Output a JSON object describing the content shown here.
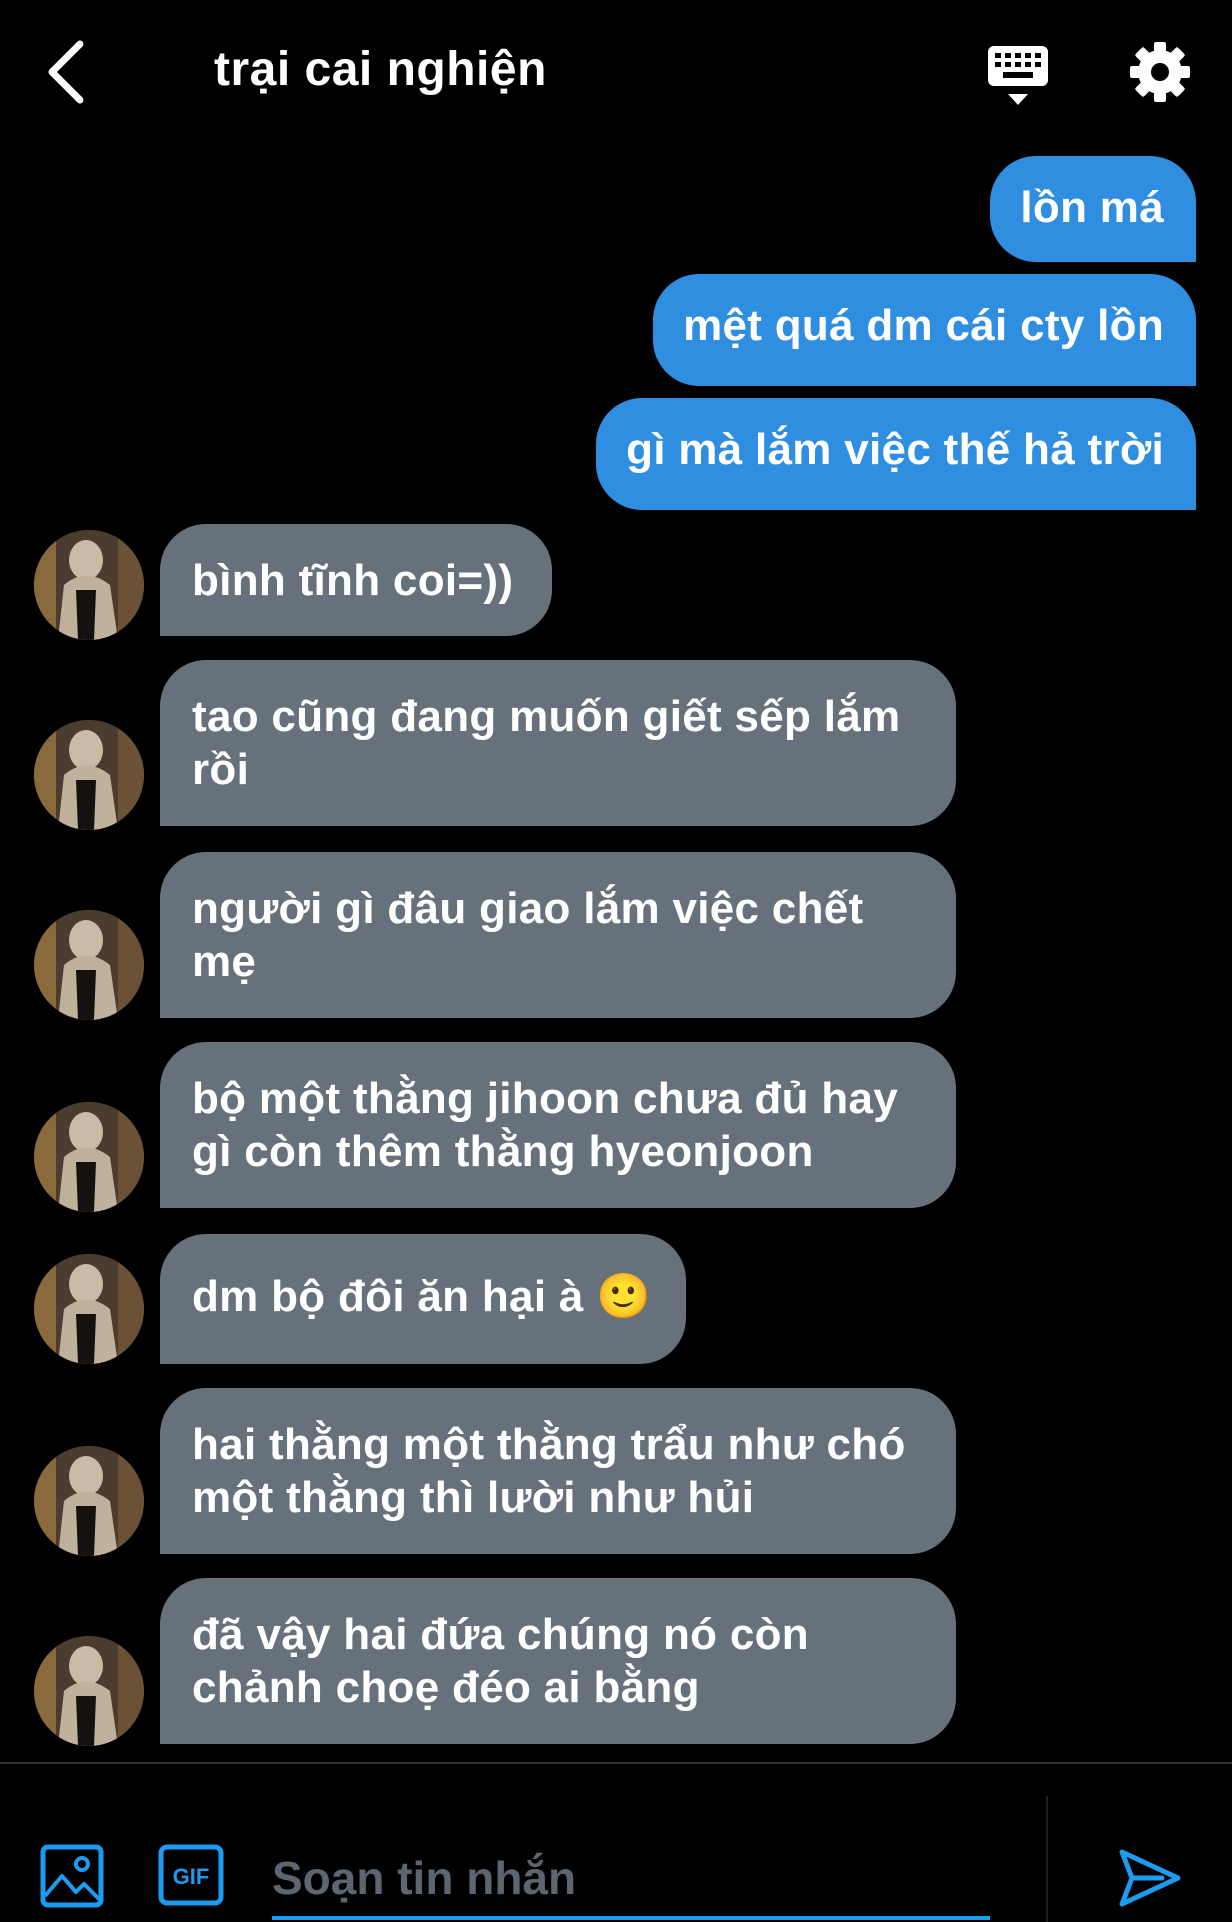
{
  "header": {
    "title": "trại cai nghiện",
    "back_icon": "chevron-left-icon",
    "keyboard_icon": "keyboard-icon",
    "settings_icon": "gear-icon"
  },
  "messages": [
    {
      "direction": "out",
      "text": "lồn má"
    },
    {
      "direction": "out",
      "text": "mệt quá dm cái cty lồn"
    },
    {
      "direction": "out",
      "text": "gì mà lắm việc thế hả trời"
    },
    {
      "direction": "in",
      "text": "bình tĩnh coi=))"
    },
    {
      "direction": "in",
      "text": "tao cũng đang muốn giết sếp lắm rồi"
    },
    {
      "direction": "in",
      "text": "người gì đâu giao lắm việc chết mẹ"
    },
    {
      "direction": "in",
      "text": "bộ một thằng jihoon chưa đủ hay gì còn thêm thằng hyeonjoon"
    },
    {
      "direction": "in",
      "text": "dm bộ đôi ăn hại à 🙂"
    },
    {
      "direction": "in",
      "text": "hai thằng một thằng trẩu như chó một thằng thì lười như hủi"
    },
    {
      "direction": "in",
      "text": "đã vậy hai đứa chúng nó còn chảnh choẹ đéo ai bằng"
    }
  ],
  "composer": {
    "placeholder": "Soạn tin nhắn",
    "value": "",
    "media_icon": "image-icon",
    "gif_icon": "gif-icon",
    "send_icon": "send-icon"
  },
  "colors": {
    "background": "#000000",
    "outgoing_bubble": "#2f8ee0",
    "incoming_bubble": "#66717c",
    "accent": "#1d9bf0",
    "placeholder": "#5c6670"
  }
}
